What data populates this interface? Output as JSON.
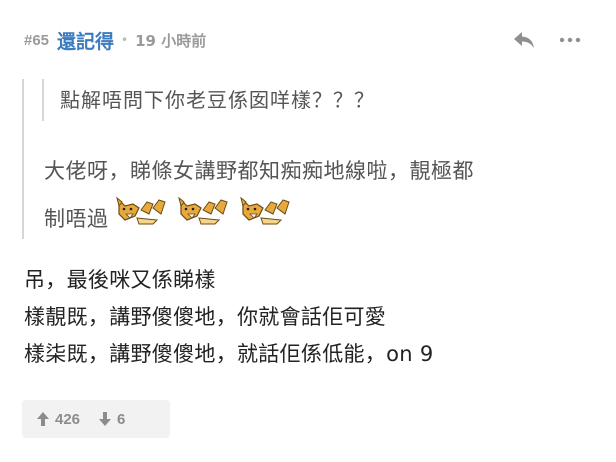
{
  "post": {
    "number": "#65",
    "username": "還記得",
    "time": "19 小時前"
  },
  "icons": {
    "reply": "reply-arrow-icon",
    "more": "more-dots-icon",
    "upvote": "arrow-up-icon",
    "downvote": "arrow-down-icon",
    "emoticon": "shiba-dog-emoticon"
  },
  "quote": {
    "nested_text": "點解唔問下你老豆係囡咩樣？？？",
    "line1": "大佬呀，睇條女講野都知痴痴地線啦，靚極都",
    "line2": "制唔過"
  },
  "body": {
    "lines": [
      "吊，最後咪又係睇樣",
      "樣靚既，講野傻傻地，你就會話佢可愛",
      "樣柒既，講野傻傻地，就話佢係低能，on 9"
    ]
  },
  "votes": {
    "up": "426",
    "down": "6"
  },
  "colors": {
    "username": "#3b7bbf",
    "meta": "#9a9a9a",
    "quote_bar": "#d6d6d6",
    "vote_bg": "#f2f2f2"
  }
}
